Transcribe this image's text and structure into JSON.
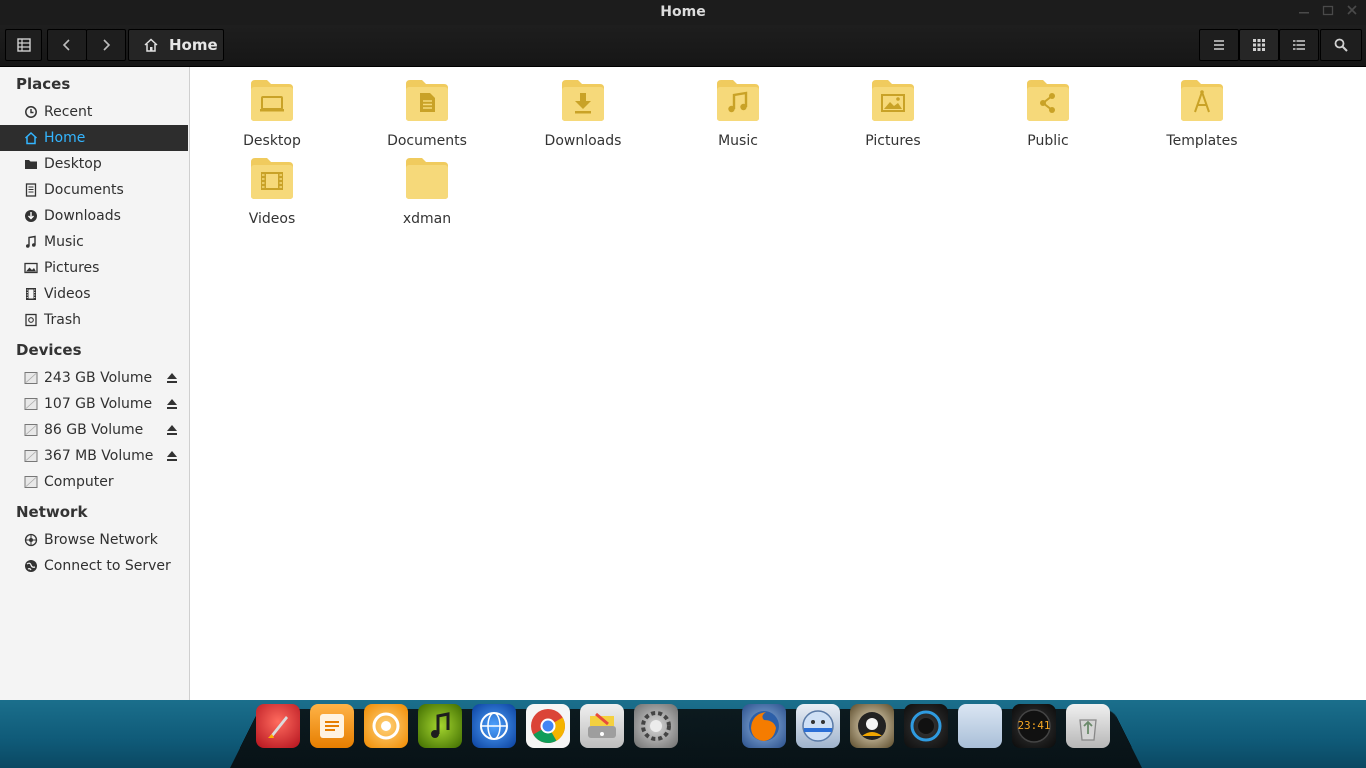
{
  "window": {
    "title": "Home"
  },
  "toolbar": {
    "breadcrumb_label": "Home"
  },
  "sidebar": {
    "places_title": "Places",
    "places": [
      {
        "label": "Recent",
        "icon": "recent-icon"
      },
      {
        "label": "Home",
        "icon": "home-icon",
        "active": true
      },
      {
        "label": "Desktop",
        "icon": "desktop-folder-icon"
      },
      {
        "label": "Documents",
        "icon": "documents-icon"
      },
      {
        "label": "Downloads",
        "icon": "downloads-icon"
      },
      {
        "label": "Music",
        "icon": "music-icon"
      },
      {
        "label": "Pictures",
        "icon": "pictures-icon"
      },
      {
        "label": "Videos",
        "icon": "videos-icon"
      },
      {
        "label": "Trash",
        "icon": "trash-icon"
      }
    ],
    "devices_title": "Devices",
    "devices": [
      {
        "label": "243 GB Volume",
        "eject": true
      },
      {
        "label": "107 GB Volume",
        "eject": true
      },
      {
        "label": "86 GB Volume",
        "eject": true
      },
      {
        "label": "367 MB Volume",
        "eject": true
      },
      {
        "label": "Computer",
        "eject": false
      }
    ],
    "network_title": "Network",
    "network": [
      {
        "label": "Browse Network"
      },
      {
        "label": "Connect to Server"
      }
    ]
  },
  "main": {
    "folders": [
      {
        "label": "Desktop",
        "icon": "desktop-icon"
      },
      {
        "label": "Documents",
        "icon": "document-icon"
      },
      {
        "label": "Downloads",
        "icon": "download-icon"
      },
      {
        "label": "Music",
        "icon": "music-note-icon"
      },
      {
        "label": "Pictures",
        "icon": "picture-icon"
      },
      {
        "label": "Public",
        "icon": "share-icon"
      },
      {
        "label": "Templates",
        "icon": "compass-icon"
      },
      {
        "label": "Videos",
        "icon": "film-icon"
      },
      {
        "label": "xdman",
        "icon": "plain-folder-icon"
      }
    ]
  },
  "dock": {
    "clock_text": "23:41"
  },
  "colors": {
    "folder": "#f6d97a",
    "folder_tab": "#f0cb5e",
    "folder_glyph": "#c9a227",
    "accent": "#33b5ff",
    "active_bg": "#2d2d2d"
  }
}
